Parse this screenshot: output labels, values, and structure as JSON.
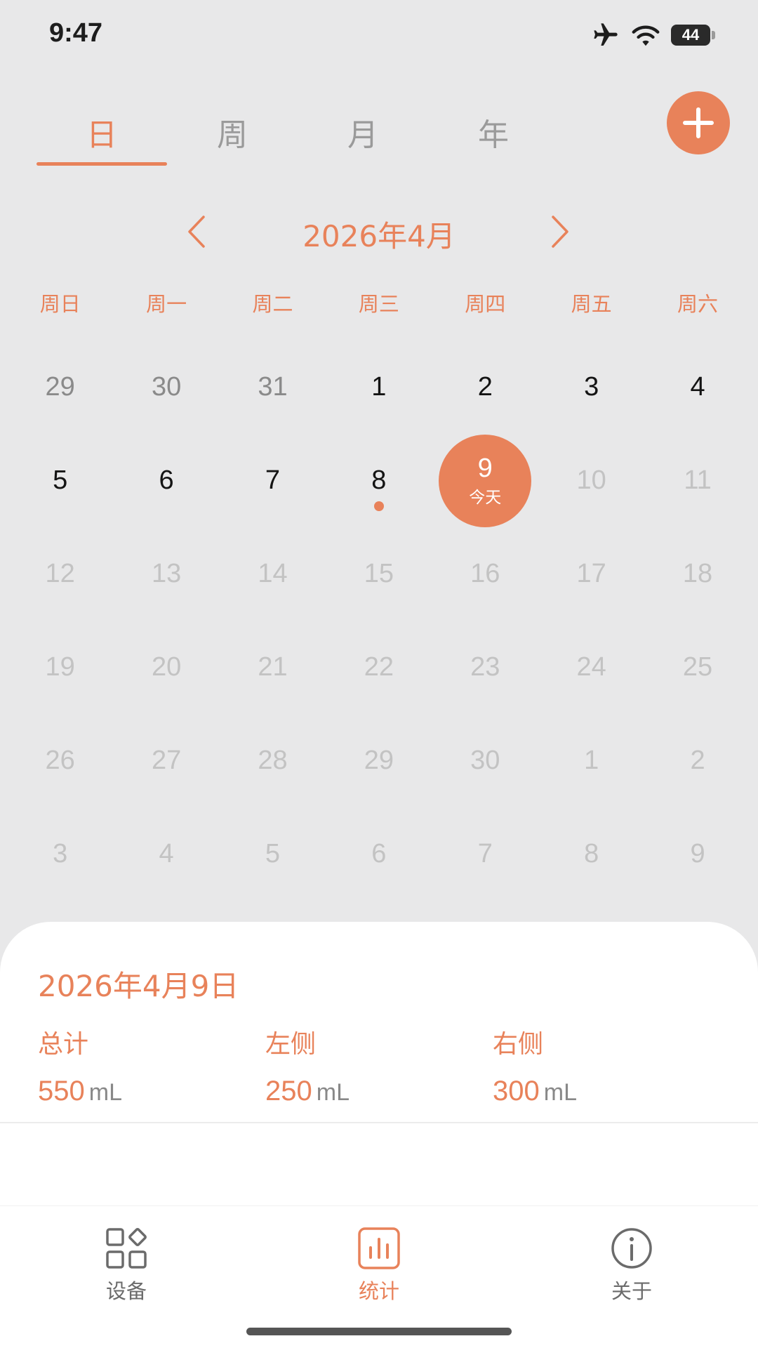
{
  "status_bar": {
    "time": "9:47",
    "battery": "44"
  },
  "period_tabs": [
    {
      "label": "日",
      "active": true
    },
    {
      "label": "周",
      "active": false
    },
    {
      "label": "月",
      "active": false
    },
    {
      "label": "年",
      "active": false
    }
  ],
  "calendar": {
    "month_title": "2026年4月",
    "weekdays": [
      "周日",
      "周一",
      "周二",
      "周三",
      "周四",
      "周五",
      "周六"
    ],
    "today_label": "今天",
    "days": [
      {
        "n": "29",
        "kind": "prev"
      },
      {
        "n": "30",
        "kind": "prev"
      },
      {
        "n": "31",
        "kind": "prev"
      },
      {
        "n": "1",
        "kind": "cur"
      },
      {
        "n": "2",
        "kind": "cur"
      },
      {
        "n": "3",
        "kind": "cur"
      },
      {
        "n": "4",
        "kind": "cur"
      },
      {
        "n": "5",
        "kind": "cur"
      },
      {
        "n": "6",
        "kind": "cur"
      },
      {
        "n": "7",
        "kind": "cur"
      },
      {
        "n": "8",
        "kind": "cur",
        "dot": true
      },
      {
        "n": "9",
        "kind": "today"
      },
      {
        "n": "10",
        "kind": "future"
      },
      {
        "n": "11",
        "kind": "future"
      },
      {
        "n": "12",
        "kind": "future"
      },
      {
        "n": "13",
        "kind": "future"
      },
      {
        "n": "14",
        "kind": "future"
      },
      {
        "n": "15",
        "kind": "future"
      },
      {
        "n": "16",
        "kind": "future"
      },
      {
        "n": "17",
        "kind": "future"
      },
      {
        "n": "18",
        "kind": "future"
      },
      {
        "n": "19",
        "kind": "future"
      },
      {
        "n": "20",
        "kind": "future"
      },
      {
        "n": "21",
        "kind": "future"
      },
      {
        "n": "22",
        "kind": "future"
      },
      {
        "n": "23",
        "kind": "future"
      },
      {
        "n": "24",
        "kind": "future"
      },
      {
        "n": "25",
        "kind": "future"
      },
      {
        "n": "26",
        "kind": "future"
      },
      {
        "n": "27",
        "kind": "future"
      },
      {
        "n": "28",
        "kind": "future"
      },
      {
        "n": "29",
        "kind": "future"
      },
      {
        "n": "30",
        "kind": "future"
      },
      {
        "n": "1",
        "kind": "next"
      },
      {
        "n": "2",
        "kind": "next"
      },
      {
        "n": "3",
        "kind": "next"
      },
      {
        "n": "4",
        "kind": "next"
      },
      {
        "n": "5",
        "kind": "next"
      },
      {
        "n": "6",
        "kind": "next"
      },
      {
        "n": "7",
        "kind": "next"
      },
      {
        "n": "8",
        "kind": "next"
      },
      {
        "n": "9",
        "kind": "next"
      }
    ]
  },
  "summary": {
    "date": "2026年4月9日",
    "stats": [
      {
        "label": "总计",
        "value": "550",
        "unit": "mL"
      },
      {
        "label": "左侧",
        "value": "250",
        "unit": "mL"
      },
      {
        "label": "右侧",
        "value": "300",
        "unit": "mL"
      }
    ]
  },
  "bottom_nav": [
    {
      "label": "设备",
      "icon": "devices-grid-icon",
      "active": false
    },
    {
      "label": "统计",
      "icon": "bar-chart-icon",
      "active": true
    },
    {
      "label": "关于",
      "icon": "info-icon",
      "active": false
    }
  ],
  "colors": {
    "accent": "#e8825a",
    "background": "#e8e8e9",
    "sheet": "#ffffff"
  }
}
